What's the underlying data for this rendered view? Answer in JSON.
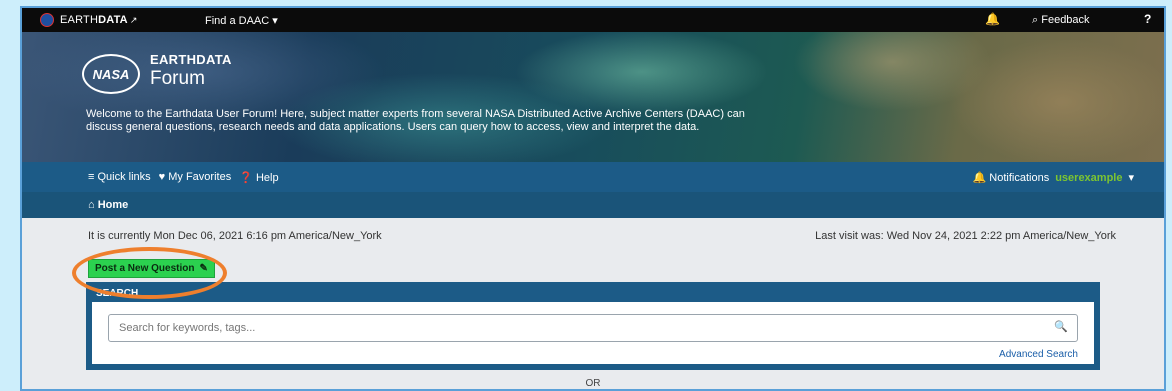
{
  "topbar": {
    "brand_prefix": "EARTH",
    "brand_bold": "DATA",
    "brand_ext_icon": "external-link-icon",
    "find_daac": "Find a DAAC",
    "find_daac_caret": "▾",
    "bell_icon": "🔔",
    "feedback": "Feedback",
    "feedback_icon": "⌕",
    "help_icon": "?"
  },
  "hero": {
    "logo_text": "NASA",
    "title_line1": "EARTHDATA",
    "title_line2": "Forum",
    "welcome": "Welcome to the Earthdata User Forum! Here, subject matter experts from several NASA Distributed Active Archive Centers (DAAC) can discuss general questions, research needs and data applications. Users can query how to access, view and interpret the data."
  },
  "nav": {
    "quick_links": "≡ Quick links",
    "favorites": "♥ My Favorites",
    "help": "❓ Help",
    "notifications": "🔔 Notifications",
    "username": "userexample",
    "user_caret": "▾"
  },
  "breadcrumb": {
    "home": "⌂ Home"
  },
  "content": {
    "current_time": "It is currently Mon Dec 06, 2021 6:16 pm America/New_York",
    "last_visit": "Last visit was: Wed Nov 24, 2021 2:22 pm America/New_York",
    "post_button": "Post a New Question",
    "post_button_icon": "✎",
    "search_heading": "SEARCH",
    "search_placeholder": "Search for keywords, tags...",
    "search_icon": "🔍",
    "advanced_search": "Advanced Search",
    "or": "OR"
  },
  "colors": {
    "navbar": "#1c5b87",
    "post_button": "#2bd14f",
    "highlight": "#ee7f2d",
    "username": "#7cc531"
  }
}
